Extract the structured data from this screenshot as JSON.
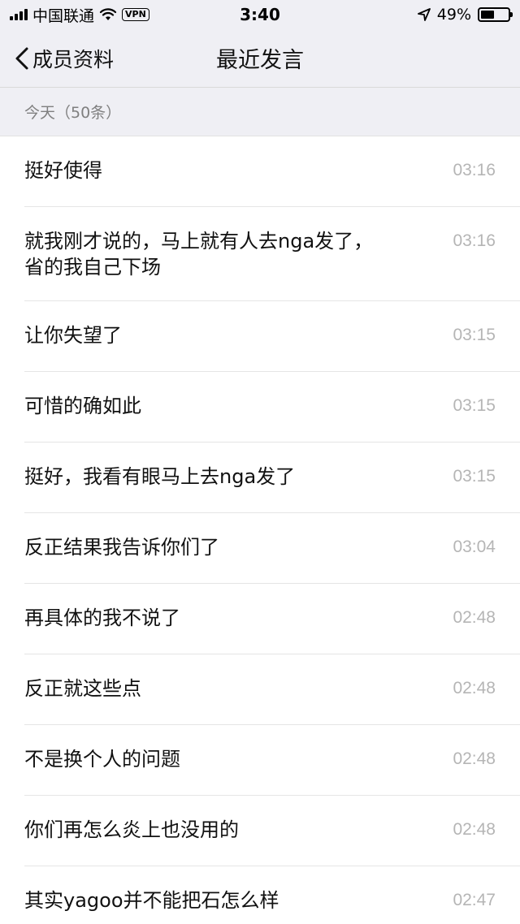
{
  "status_bar": {
    "carrier": "中国联通",
    "vpn": "VPN",
    "time": "3:40",
    "battery": "49%",
    "battery_level": 0.49
  },
  "nav": {
    "back_label": "成员资料",
    "title": "最近发言"
  },
  "section": {
    "header": "今天（50条）"
  },
  "messages": [
    {
      "text": "挺好使得",
      "time": "03:16"
    },
    {
      "text": "就我刚才说的，马上就有人去nga发了，省的我自己下场",
      "time": "03:16"
    },
    {
      "text": "让你失望了",
      "time": "03:15"
    },
    {
      "text": "可惜的确如此",
      "time": "03:15"
    },
    {
      "text": "挺好，我看有眼马上去nga发了",
      "time": "03:15"
    },
    {
      "text": "反正结果我告诉你们了",
      "time": "03:04"
    },
    {
      "text": "再具体的我不说了",
      "time": "02:48"
    },
    {
      "text": "反正就这些点",
      "time": "02:48"
    },
    {
      "text": "不是换个人的问题",
      "time": "02:48"
    },
    {
      "text": "你们再怎么炎上也没用的",
      "time": "02:48"
    },
    {
      "text": "其实yagoo并不能把石怎么样",
      "time": "02:47"
    }
  ]
}
